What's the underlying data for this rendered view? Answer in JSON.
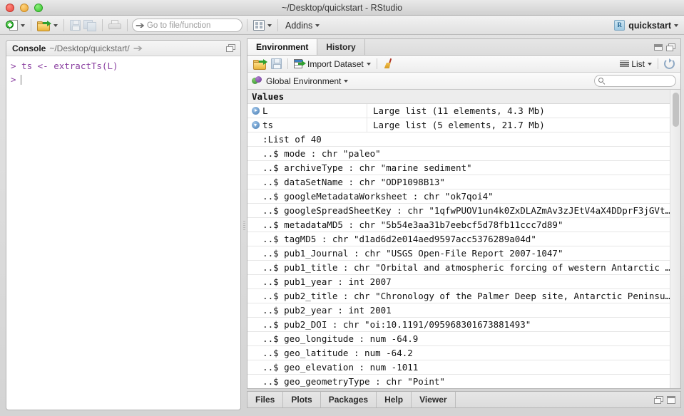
{
  "window": {
    "title": "~/Desktop/quickstart - RStudio",
    "traffic_lights": [
      "close-red",
      "minimize-yellow",
      "zoom-green"
    ]
  },
  "toolbar": {
    "new_file_icon": "new-file-icon",
    "open_file_icon": "open-folder-icon",
    "save_icon": "save-icon",
    "save_all_icon": "save-all-icon",
    "print_icon": "print-icon",
    "goto_placeholder": "Go to file/function",
    "goto_value": "",
    "panes_icon": "pane-layout-icon",
    "addins_label": "Addins",
    "project_name": "quickstart",
    "project_icon": "r-project-icon"
  },
  "console": {
    "title": "Console",
    "path": "~/Desktop/quickstart/",
    "share_icon": "share-arrow-icon",
    "maximize_icon": "restore-window-icon",
    "lines": [
      "> ts <- extractTs(L)"
    ],
    "prompt": ">",
    "text_color": "#8a3fa0"
  },
  "environment": {
    "tabs": [
      {
        "label": "Environment",
        "active": true
      },
      {
        "label": "History",
        "active": false
      }
    ],
    "toolbar": {
      "open_icon": "open-folder-icon",
      "save_icon": "save-workspace-icon",
      "import_label": "Import Dataset",
      "import_icon": "import-dataset-icon",
      "clear_icon": "broom-clear-icon",
      "view_mode": "List",
      "view_icon": "list-view-icon",
      "refresh_icon": "refresh-icon"
    },
    "scope": {
      "label": "Global Environment",
      "icon": "globe-environment-icon",
      "search_placeholder": "",
      "search_value": "",
      "search_icon": "search-icon"
    },
    "section_header": "Values",
    "columns": [
      "name",
      "value"
    ],
    "rows": [
      {
        "type": "variable",
        "expander": "collapsed",
        "name": "L",
        "value": "Large list (11 elements, 4.3 Mb)"
      },
      {
        "type": "variable",
        "expander": "expanded",
        "name": "ts",
        "value": "Large list (5 elements, 21.7 Mb)"
      },
      {
        "type": "detail",
        "text": "  :List of 40"
      },
      {
        "type": "detail",
        "text": "  ..$ mode : chr \"paleo\""
      },
      {
        "type": "detail",
        "text": "  ..$ archiveType : chr \"marine sediment\""
      },
      {
        "type": "detail",
        "text": "  ..$ dataSetName : chr \"ODP1098B13\""
      },
      {
        "type": "detail",
        "text": "  ..$ googleMetadataWorksheet : chr \"ok7qoi4\""
      },
      {
        "type": "detail",
        "text": "  ..$ googleSpreadSheetKey : chr \"1qfwPUOV1un4k0ZxDLAZmAv3zJEtV4aX4DDprF3jGVt…"
      },
      {
        "type": "detail",
        "text": "  ..$ metadataMD5 : chr \"5b54e3aa31b7eebcf5d78fb11ccc7d89\""
      },
      {
        "type": "detail",
        "text": "  ..$ tagMD5 : chr \"d1ad6d2e014aed9597acc5376289a04d\""
      },
      {
        "type": "detail",
        "text": "  ..$ pub1_Journal : chr \"USGS Open-File Report 2007-1047\""
      },
      {
        "type": "detail",
        "text": "  ..$ pub1_title : chr \"Orbital and atmospheric forcing of western Antarctic …"
      },
      {
        "type": "detail",
        "text": "  ..$ pub1_year : int 2007"
      },
      {
        "type": "detail",
        "text": "  ..$ pub2_title : chr \"Chronology of the Palmer Deep site, Antarctic Peninsu…"
      },
      {
        "type": "detail",
        "text": "  ..$ pub2_year : int 2001"
      },
      {
        "type": "detail",
        "text": "  ..$ pub2_DOI : chr \"oi:10.1191/095968301673881493\""
      },
      {
        "type": "detail",
        "text": "  ..$ geo_longitude : num -64.9"
      },
      {
        "type": "detail",
        "text": "  ..$ geo_latitude : num -64.2"
      },
      {
        "type": "detail",
        "text": "  ..$ geo_elevation : num -1011"
      },
      {
        "type": "detail",
        "text": "  ..$ geo_geometryType : chr \"Point\""
      }
    ],
    "scrollbar": {
      "orientation": "vertical",
      "thumb_at_top": true
    }
  },
  "bottom_panel": {
    "tabs": [
      "Files",
      "Plots",
      "Packages",
      "Help",
      "Viewer"
    ],
    "minimize_icon": "restore-window-icon",
    "maximize_icon": "maximize-window-icon"
  }
}
